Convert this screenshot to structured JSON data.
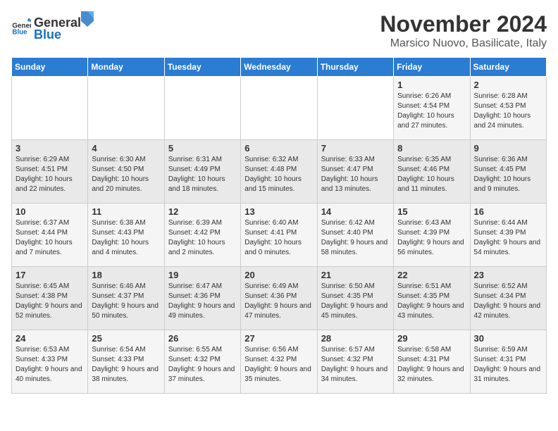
{
  "logo": {
    "general": "General",
    "blue": "Blue"
  },
  "title": {
    "month": "November 2024",
    "location": "Marsico Nuovo, Basilicate, Italy"
  },
  "days_of_week": [
    "Sunday",
    "Monday",
    "Tuesday",
    "Wednesday",
    "Thursday",
    "Friday",
    "Saturday"
  ],
  "weeks": [
    [
      {
        "day": "",
        "info": ""
      },
      {
        "day": "",
        "info": ""
      },
      {
        "day": "",
        "info": ""
      },
      {
        "day": "",
        "info": ""
      },
      {
        "day": "",
        "info": ""
      },
      {
        "day": "1",
        "info": "Sunrise: 6:26 AM\nSunset: 4:54 PM\nDaylight: 10 hours and 27 minutes."
      },
      {
        "day": "2",
        "info": "Sunrise: 6:28 AM\nSunset: 4:53 PM\nDaylight: 10 hours and 24 minutes."
      }
    ],
    [
      {
        "day": "3",
        "info": "Sunrise: 6:29 AM\nSunset: 4:51 PM\nDaylight: 10 hours and 22 minutes."
      },
      {
        "day": "4",
        "info": "Sunrise: 6:30 AM\nSunset: 4:50 PM\nDaylight: 10 hours and 20 minutes."
      },
      {
        "day": "5",
        "info": "Sunrise: 6:31 AM\nSunset: 4:49 PM\nDaylight: 10 hours and 18 minutes."
      },
      {
        "day": "6",
        "info": "Sunrise: 6:32 AM\nSunset: 4:48 PM\nDaylight: 10 hours and 15 minutes."
      },
      {
        "day": "7",
        "info": "Sunrise: 6:33 AM\nSunset: 4:47 PM\nDaylight: 10 hours and 13 minutes."
      },
      {
        "day": "8",
        "info": "Sunrise: 6:35 AM\nSunset: 4:46 PM\nDaylight: 10 hours and 11 minutes."
      },
      {
        "day": "9",
        "info": "Sunrise: 6:36 AM\nSunset: 4:45 PM\nDaylight: 10 hours and 9 minutes."
      }
    ],
    [
      {
        "day": "10",
        "info": "Sunrise: 6:37 AM\nSunset: 4:44 PM\nDaylight: 10 hours and 7 minutes."
      },
      {
        "day": "11",
        "info": "Sunrise: 6:38 AM\nSunset: 4:43 PM\nDaylight: 10 hours and 4 minutes."
      },
      {
        "day": "12",
        "info": "Sunrise: 6:39 AM\nSunset: 4:42 PM\nDaylight: 10 hours and 2 minutes."
      },
      {
        "day": "13",
        "info": "Sunrise: 6:40 AM\nSunset: 4:41 PM\nDaylight: 10 hours and 0 minutes."
      },
      {
        "day": "14",
        "info": "Sunrise: 6:42 AM\nSunset: 4:40 PM\nDaylight: 9 hours and 58 minutes."
      },
      {
        "day": "15",
        "info": "Sunrise: 6:43 AM\nSunset: 4:39 PM\nDaylight: 9 hours and 56 minutes."
      },
      {
        "day": "16",
        "info": "Sunrise: 6:44 AM\nSunset: 4:39 PM\nDaylight: 9 hours and 54 minutes."
      }
    ],
    [
      {
        "day": "17",
        "info": "Sunrise: 6:45 AM\nSunset: 4:38 PM\nDaylight: 9 hours and 52 minutes."
      },
      {
        "day": "18",
        "info": "Sunrise: 6:46 AM\nSunset: 4:37 PM\nDaylight: 9 hours and 50 minutes."
      },
      {
        "day": "19",
        "info": "Sunrise: 6:47 AM\nSunset: 4:36 PM\nDaylight: 9 hours and 49 minutes."
      },
      {
        "day": "20",
        "info": "Sunrise: 6:49 AM\nSunset: 4:36 PM\nDaylight: 9 hours and 47 minutes."
      },
      {
        "day": "21",
        "info": "Sunrise: 6:50 AM\nSunset: 4:35 PM\nDaylight: 9 hours and 45 minutes."
      },
      {
        "day": "22",
        "info": "Sunrise: 6:51 AM\nSunset: 4:35 PM\nDaylight: 9 hours and 43 minutes."
      },
      {
        "day": "23",
        "info": "Sunrise: 6:52 AM\nSunset: 4:34 PM\nDaylight: 9 hours and 42 minutes."
      }
    ],
    [
      {
        "day": "24",
        "info": "Sunrise: 6:53 AM\nSunset: 4:33 PM\nDaylight: 9 hours and 40 minutes."
      },
      {
        "day": "25",
        "info": "Sunrise: 6:54 AM\nSunset: 4:33 PM\nDaylight: 9 hours and 38 minutes."
      },
      {
        "day": "26",
        "info": "Sunrise: 6:55 AM\nSunset: 4:32 PM\nDaylight: 9 hours and 37 minutes."
      },
      {
        "day": "27",
        "info": "Sunrise: 6:56 AM\nSunset: 4:32 PM\nDaylight: 9 hours and 35 minutes."
      },
      {
        "day": "28",
        "info": "Sunrise: 6:57 AM\nSunset: 4:32 PM\nDaylight: 9 hours and 34 minutes."
      },
      {
        "day": "29",
        "info": "Sunrise: 6:58 AM\nSunset: 4:31 PM\nDaylight: 9 hours and 32 minutes."
      },
      {
        "day": "30",
        "info": "Sunrise: 6:59 AM\nSunset: 4:31 PM\nDaylight: 9 hours and 31 minutes."
      }
    ]
  ]
}
